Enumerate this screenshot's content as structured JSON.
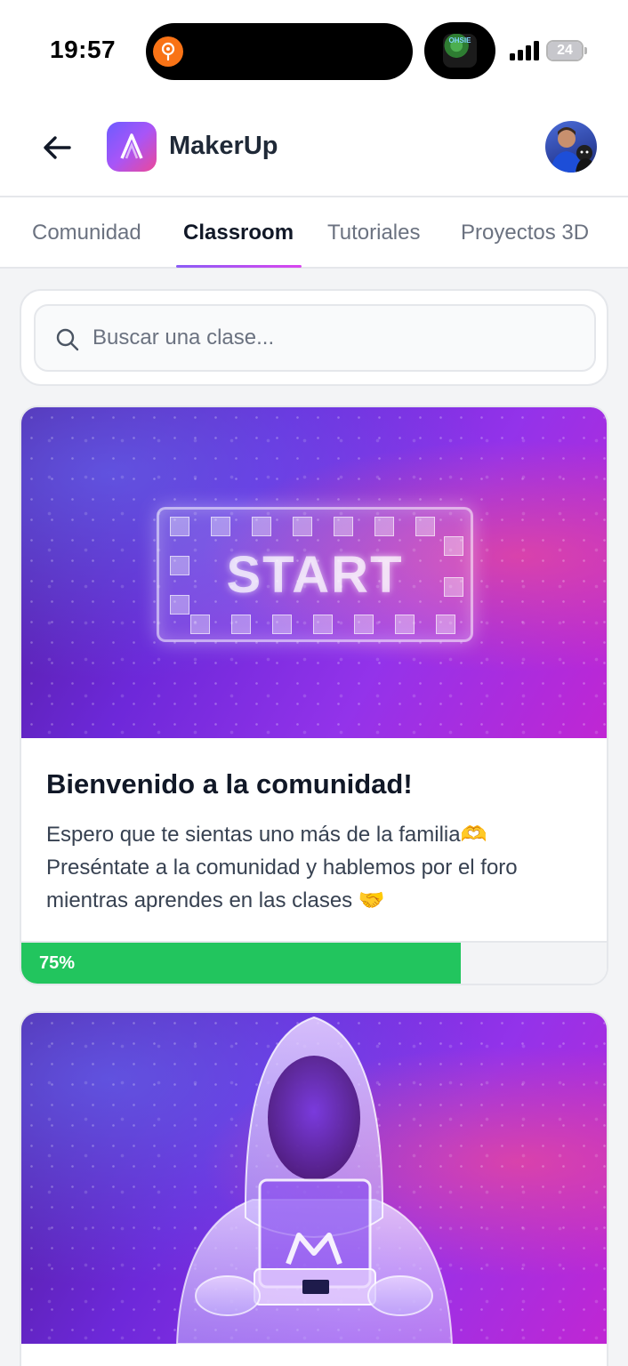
{
  "status_bar": {
    "time": "19:57",
    "battery": "24",
    "island_thumb_label": "OHSIE"
  },
  "header": {
    "title": "MakerUp"
  },
  "tabs": [
    {
      "label": "Comunidad",
      "active": false
    },
    {
      "label": "Classroom",
      "active": true
    },
    {
      "label": "Tutoriales",
      "active": false
    },
    {
      "label": "Proyectos 3D",
      "active": false
    }
  ],
  "search": {
    "placeholder": "Buscar una clase..."
  },
  "courses": [
    {
      "cover_text": "START",
      "title": "Bienvenido a la comunidad!",
      "description_lines": [
        "Espero que te sientas uno más de la familia🫶",
        "Preséntate a la comunidad y hablemos por el foro",
        "mientras aprendes en las clases 🤝"
      ],
      "progress": 75,
      "progress_label": "75%"
    },
    {
      "cover_text": ""
    }
  ],
  "colors": {
    "progress": "#22c55e",
    "accent_purple": "#8b5cf6",
    "accent_pink": "#d946ef"
  }
}
